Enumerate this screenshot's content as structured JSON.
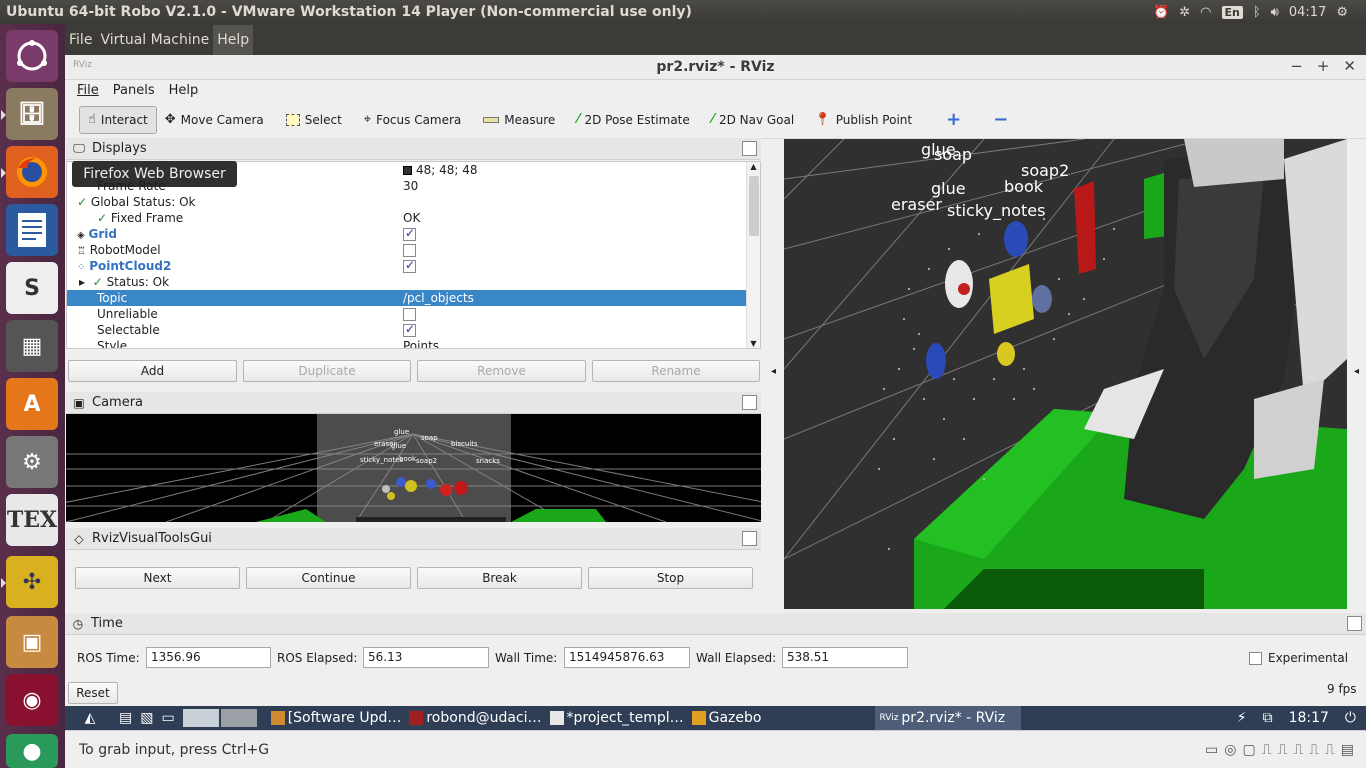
{
  "topbar": {
    "title": "Ubuntu 64-bit Robo V2.1.0 - VMware Workstation 14 Player (Non-commercial use only)",
    "keyboard": "En",
    "clock": "04:17"
  },
  "launcher": {
    "tooltip": "Firefox Web Browser",
    "items": [
      "ubuntu-dash",
      "file-cabinet",
      "firefox",
      "writer",
      "slack",
      "calculator",
      "software-center",
      "system-settings",
      "texmaker",
      "puzzle-app",
      "image-viewer",
      "ruby-app",
      "extra-app"
    ]
  },
  "vm_menu": [
    "File",
    "Virtual Machine",
    "Help"
  ],
  "rviz": {
    "window_title": "pr2.rviz* - RViz",
    "logo": "RViz",
    "menu": [
      "File",
      "Panels",
      "Help"
    ],
    "toolbar": [
      {
        "label": "Interact",
        "icon": "hand-icon"
      },
      {
        "label": "Move Camera",
        "icon": "move-camera-icon"
      },
      {
        "label": "Select",
        "icon": "select-icon"
      },
      {
        "label": "Focus Camera",
        "icon": "focus-icon"
      },
      {
        "label": "Measure",
        "icon": "ruler-icon"
      },
      {
        "label": "2D Pose Estimate",
        "icon": "pose-arrow-icon"
      },
      {
        "label": "2D Nav Goal",
        "icon": "nav-arrow-icon"
      },
      {
        "label": "Publish Point",
        "icon": "pin-icon"
      }
    ],
    "displays": {
      "title": "Displays",
      "rows": [
        {
          "key": "",
          "value": "48; 48; 48"
        },
        {
          "key": "Frame Rate",
          "value": "30"
        },
        {
          "key": "Global Status: Ok",
          "value": ""
        },
        {
          "key": "Fixed Frame",
          "value": "OK"
        },
        {
          "key": "Grid",
          "value": ""
        },
        {
          "key": "RobotModel",
          "value": ""
        },
        {
          "key": "PointCloud2",
          "value": ""
        },
        {
          "key": "Status: Ok",
          "value": ""
        },
        {
          "key": "Topic",
          "value": "/pcl_objects"
        },
        {
          "key": "Unreliable",
          "value": ""
        },
        {
          "key": "Selectable",
          "value": ""
        },
        {
          "key": "Style",
          "value": "Points"
        }
      ],
      "buttons": [
        "Add",
        "Duplicate",
        "Remove",
        "Rename"
      ]
    },
    "camera": {
      "title": "Camera",
      "labels": [
        "glue",
        "eraser",
        "glue",
        "soap",
        "biscuits",
        "sticky_notes",
        "book",
        "soap2",
        "snacks"
      ]
    },
    "visual_tools": {
      "title": "RvizVisualToolsGui",
      "buttons": [
        "Next",
        "Continue",
        "Break",
        "Stop"
      ]
    },
    "view3d": {
      "labels": [
        "glue",
        "soap",
        "soap2",
        "book",
        "glue",
        "eraser",
        "sticky_notes"
      ]
    },
    "time": {
      "title": "Time",
      "ros_time_label": "ROS Time:",
      "ros_time": "1356.96",
      "ros_elapsed_label": "ROS Elapsed:",
      "ros_elapsed": "56.13",
      "wall_time_label": "Wall Time:",
      "wall_time": "1514945876.63",
      "wall_elapsed_label": "Wall Elapsed:",
      "wall_elapsed": "538.51",
      "experimental_label": "Experimental",
      "reset_label": "Reset",
      "fps": "9 fps"
    }
  },
  "taskbar": {
    "tasks": [
      "[Software Upd…",
      "robond@udaci…",
      "*project_templ…",
      "Gazebo",
      "pr2.rviz* - RViz"
    ],
    "clock": "18:17"
  },
  "status": {
    "message": "To grab input, press Ctrl+G"
  }
}
